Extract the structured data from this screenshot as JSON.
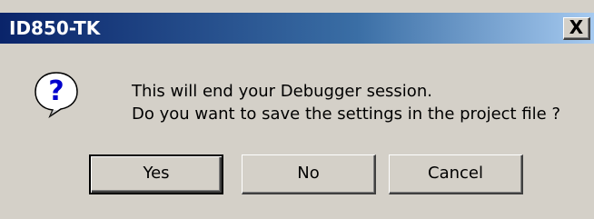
{
  "dialog": {
    "title": "ID850-TK",
    "close_glyph": "X",
    "icon": "question-icon",
    "message_lines": [
      "This will end your Debugger session.",
      "Do you want to save the settings in the project file ?"
    ],
    "buttons": {
      "yes": "Yes",
      "no": "No",
      "cancel": "Cancel"
    }
  },
  "colors": {
    "title_gradient_start": "#0a246a",
    "title_gradient_end": "#a6caf0",
    "dialog_face": "#d4d0c8",
    "icon_blue": "#0000cc"
  }
}
